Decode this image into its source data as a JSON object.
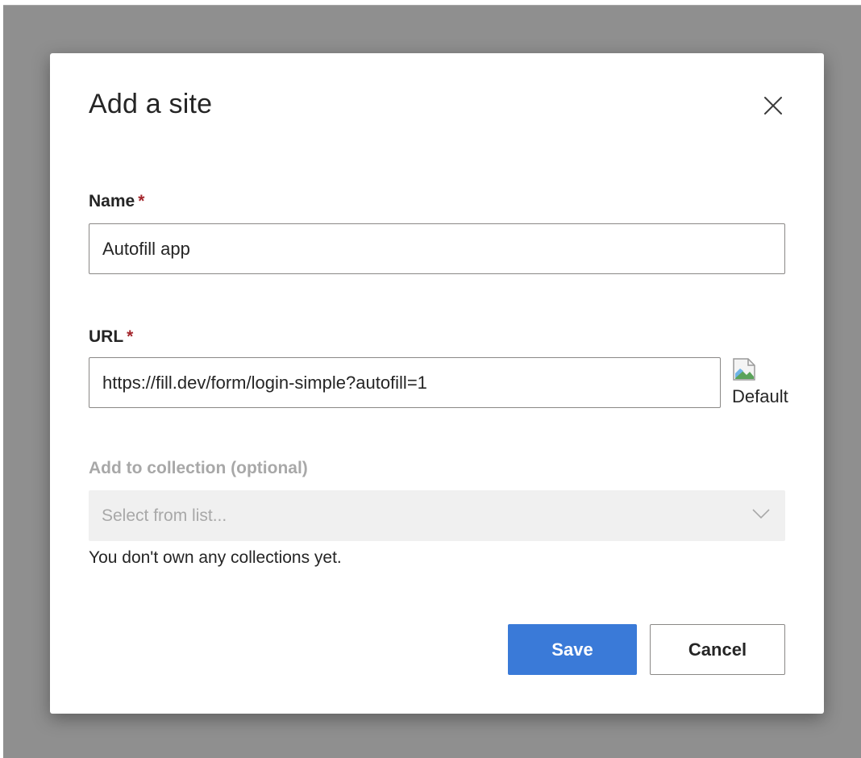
{
  "dialog": {
    "title": "Add a site",
    "close_label": "Close"
  },
  "fields": {
    "name": {
      "label": "Name",
      "required_marker": "*",
      "value": "Autofill app"
    },
    "url": {
      "label": "URL",
      "required_marker": "*",
      "value": "https://fill.dev/form/login-simple?autofill=1",
      "favicon_alt": "Default"
    },
    "collection": {
      "label": "Add to collection (optional)",
      "placeholder": "Select from list...",
      "disabled": true,
      "helper_text": "You don't own any collections yet."
    }
  },
  "actions": {
    "save_label": "Save",
    "cancel_label": "Cancel"
  },
  "colors": {
    "primary": "#3a7ad8",
    "required": "#a4262c",
    "backdrop": "#8f8f8f",
    "disabled_text": "#a8a8a8"
  },
  "icons": {
    "close": "close-icon",
    "favicon": "broken-image-icon",
    "dropdown": "chevron-down-icon"
  }
}
